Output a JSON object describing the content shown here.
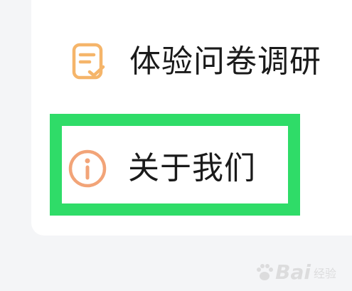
{
  "menu": {
    "items": [
      {
        "label": "体验问卷调研",
        "icon": "survey-checklist-icon",
        "icon_color": "#f5b56a"
      },
      {
        "label": "关于我们",
        "icon": "info-circle-icon",
        "icon_color": "#f2a478"
      }
    ]
  },
  "highlight": {
    "color": "#2fdc68"
  },
  "watermark": {
    "text": "Bai",
    "sub": "经验"
  }
}
